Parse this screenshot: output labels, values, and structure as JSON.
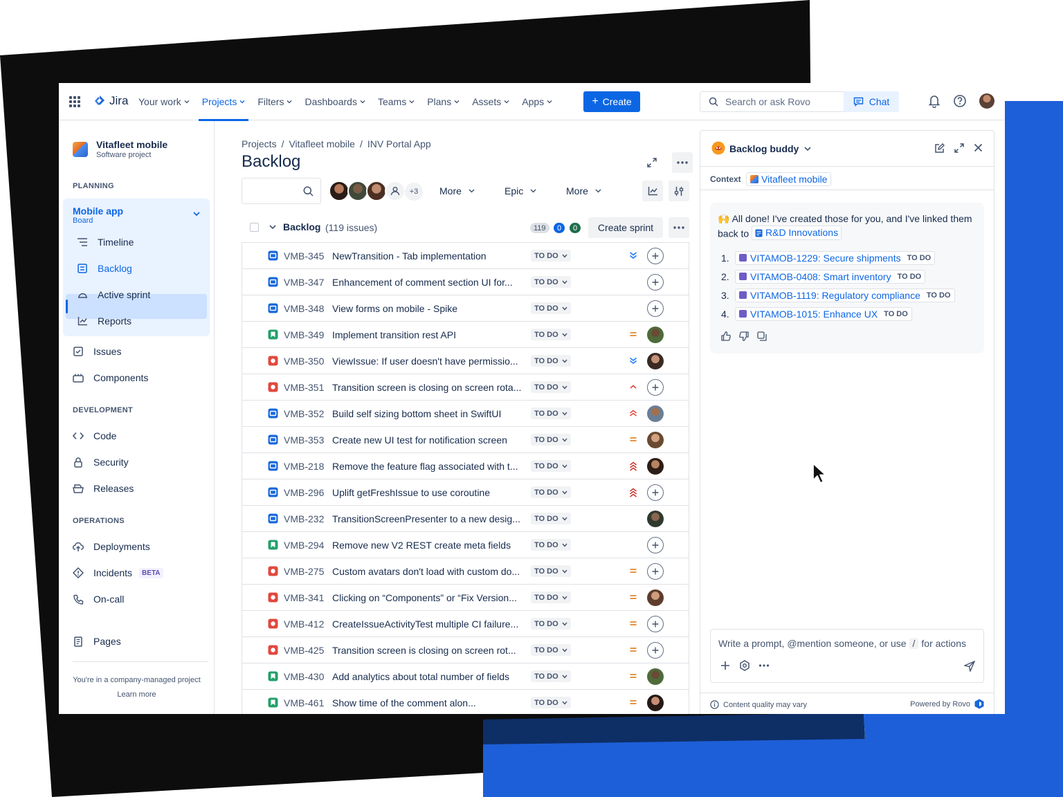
{
  "colors": {
    "accent": "#0c66e4",
    "black_backdrop": "#0d0d0e",
    "blue_backdrop": "#1d5fd8"
  },
  "topnav": {
    "logo": "Jira",
    "items": [
      {
        "label": "Your work"
      },
      {
        "label": "Projects",
        "active": true
      },
      {
        "label": "Filters"
      },
      {
        "label": "Dashboards"
      },
      {
        "label": "Teams"
      },
      {
        "label": "Plans"
      },
      {
        "label": "Assets"
      },
      {
        "label": "Apps"
      }
    ],
    "create": "Create",
    "search_placeholder": "Search or ask Rovo",
    "chat": "Chat"
  },
  "sidebar": {
    "project_name": "Vitafleet mobile",
    "project_type": "Software project",
    "planning_title": "PLANNING",
    "board_name": "Mobile app",
    "board_sub": "Board",
    "planning_items": [
      "Timeline",
      "Backlog",
      "Active sprint",
      "Reports"
    ],
    "items_general": [
      "Issues",
      "Components"
    ],
    "development_title": "DEVELOPMENT",
    "development_items": [
      "Code",
      "Security",
      "Releases"
    ],
    "operations_title": "OPERATIONS",
    "operations_items": [
      "Deployments",
      "Incidents",
      "On-call"
    ],
    "beta": "BETA",
    "pages": "Pages",
    "footer": "You're in a company-managed project",
    "learn_more": "Learn more"
  },
  "main": {
    "breadcrumbs": [
      "Projects",
      "/",
      "Vitafleet mobile",
      "/",
      "INV Portal App"
    ],
    "title": "Backlog",
    "avatars_more": "+3",
    "filters": [
      "More",
      "Epic",
      "More"
    ],
    "backlog_label": "Backlog",
    "backlog_count": "(119 issues)",
    "pill_total": "119",
    "pill_progress": "0",
    "pill_done": "0",
    "create_sprint": "Create sprint",
    "issues": [
      {
        "type": "task",
        "key": "VMB-345",
        "summary": "NewTransition - Tab implementation",
        "status": "TO DO",
        "priority": "lowest",
        "assignee": "none"
      },
      {
        "type": "task",
        "key": "VMB-347",
        "summary": "Enhancement of comment section UI for...",
        "status": "TO DO",
        "priority": "none",
        "assignee": "none"
      },
      {
        "type": "task",
        "key": "VMB-348",
        "summary": "View forms on mobile - Spike",
        "status": "TO DO",
        "priority": "none",
        "assignee": "none"
      },
      {
        "type": "story",
        "key": "VMB-349",
        "summary": "Implement transition rest API",
        "status": "TO DO",
        "priority": "medium",
        "assignee": "a1"
      },
      {
        "type": "bug",
        "key": "VMB-350",
        "summary": "ViewIssue: If user doesn't have permissio...",
        "status": "TO DO",
        "priority": "low",
        "assignee": "a2"
      },
      {
        "type": "bug",
        "key": "VMB-351",
        "summary": "Transition screen is closing on screen rota...",
        "status": "TO DO",
        "priority": "minor",
        "assignee": "none"
      },
      {
        "type": "task",
        "key": "VMB-352",
        "summary": "Build self sizing bottom sheet in SwiftUI",
        "status": "TO DO",
        "priority": "high",
        "assignee": "a3"
      },
      {
        "type": "task",
        "key": "VMB-353",
        "summary": "Create new UI test for notification screen",
        "status": "TO DO",
        "priority": "medium",
        "assignee": "a4"
      },
      {
        "type": "task",
        "key": "VMB-218",
        "summary": "Remove the feature flag associated with t...",
        "status": "TO DO",
        "priority": "highest",
        "assignee": "a5"
      },
      {
        "type": "task",
        "key": "VMB-296",
        "summary": "Uplift getFreshIssue to use coroutine",
        "status": "TO DO",
        "priority": "highest",
        "assignee": "none"
      },
      {
        "type": "task",
        "key": "VMB-232",
        "summary": "TransitionScreenPresenter to a new desig...",
        "status": "TO DO",
        "priority": "none",
        "assignee": "a6"
      },
      {
        "type": "story",
        "key": "VMB-294",
        "summary": "Remove new V2 REST create meta fields",
        "status": "TO DO",
        "priority": "none",
        "assignee": "none"
      },
      {
        "type": "bug",
        "key": "VMB-275",
        "summary": "Custom avatars don't load with custom do...",
        "status": "TO DO",
        "priority": "medium",
        "assignee": "none"
      },
      {
        "type": "bug",
        "key": "VMB-341",
        "summary": "Clicking on “Components” or “Fix Version...",
        "status": "TO DO",
        "priority": "medium",
        "assignee": "a7"
      },
      {
        "type": "bug",
        "key": "VMB-412",
        "summary": "CreateIssueActivityTest multiple CI failure...",
        "status": "TO DO",
        "priority": "medium",
        "assignee": "none"
      },
      {
        "type": "bug",
        "key": "VMB-425",
        "summary": "Transition screen is closing on screen rot...",
        "status": "TO DO",
        "priority": "medium",
        "assignee": "none"
      },
      {
        "type": "story",
        "key": "VMB-430",
        "summary": "Add analytics about total number of fields",
        "status": "TO DO",
        "priority": "medium",
        "assignee": "a1"
      },
      {
        "type": "story",
        "key": "VMB-461",
        "summary": "Show time of the comment alon...",
        "status": "TO DO",
        "priority": "medium",
        "assignee": "a8"
      }
    ]
  },
  "panel": {
    "title": "Backlog buddy",
    "context_label": "Context",
    "context_value": "Vitafleet mobile",
    "message_emoji": "🙌",
    "message_part1": "All done! I've created those for you, and I've linked them back to",
    "message_link": "R&D Innovations",
    "items": [
      {
        "num": "1.",
        "label": "VITAMOB-1229: Secure shipments",
        "status": "TO DO"
      },
      {
        "num": "2.",
        "label": "VITAMOB-0408: Smart inventory",
        "status": "TO DO"
      },
      {
        "num": "3.",
        "label": "VITAMOB-1119: Regulatory compliance",
        "status": "TO DO"
      },
      {
        "num": "4.",
        "label": "VITAMOB-1015: Enhance UX",
        "status": "TO DO"
      }
    ],
    "prompt_part1": "Write a prompt, @mention someone, or use",
    "prompt_slash": "/",
    "prompt_part2": "for actions",
    "footer_left": "Content quality may vary",
    "footer_right": "Powered by Rovo"
  }
}
